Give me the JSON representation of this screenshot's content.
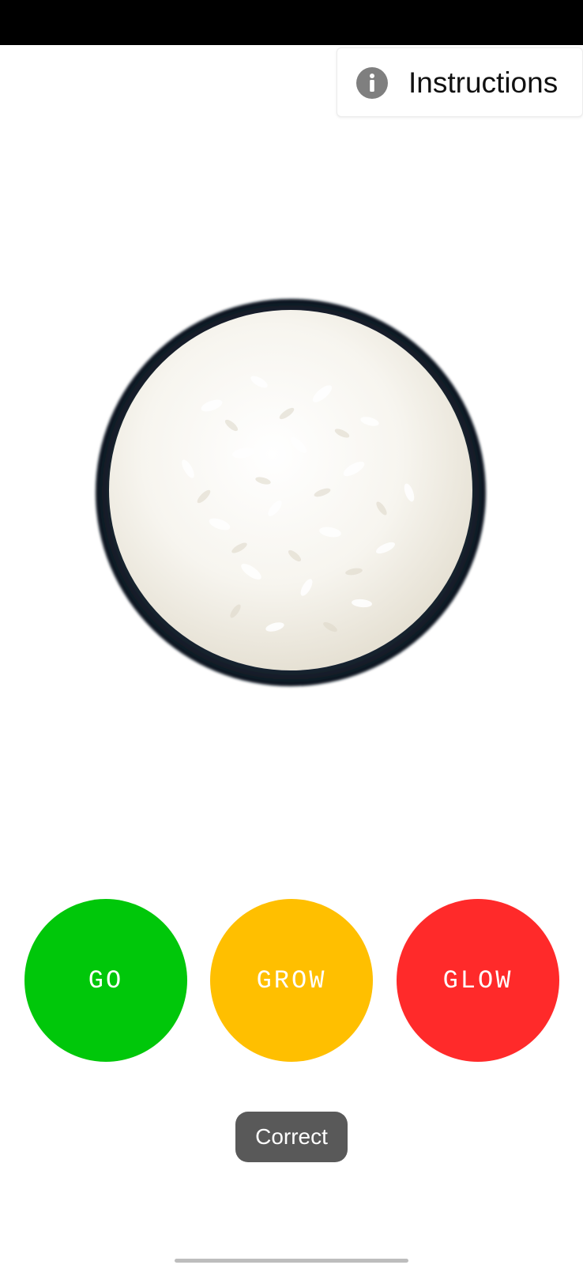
{
  "header": {
    "instructions_label": "Instructions",
    "instructions_icon": "info-icon"
  },
  "main": {
    "food_item": "rice-bowl-image"
  },
  "choices": [
    {
      "label": "GO",
      "color": "#00C70A"
    },
    {
      "label": "GROW",
      "color": "#FFBF00"
    },
    {
      "label": "GLOW",
      "color": "#FF2A2A"
    }
  ],
  "feedback": {
    "text": "Correct"
  },
  "colors": {
    "status_bar": "#000000",
    "info_icon": "#7f7f7f",
    "toast_background": "#595959"
  }
}
